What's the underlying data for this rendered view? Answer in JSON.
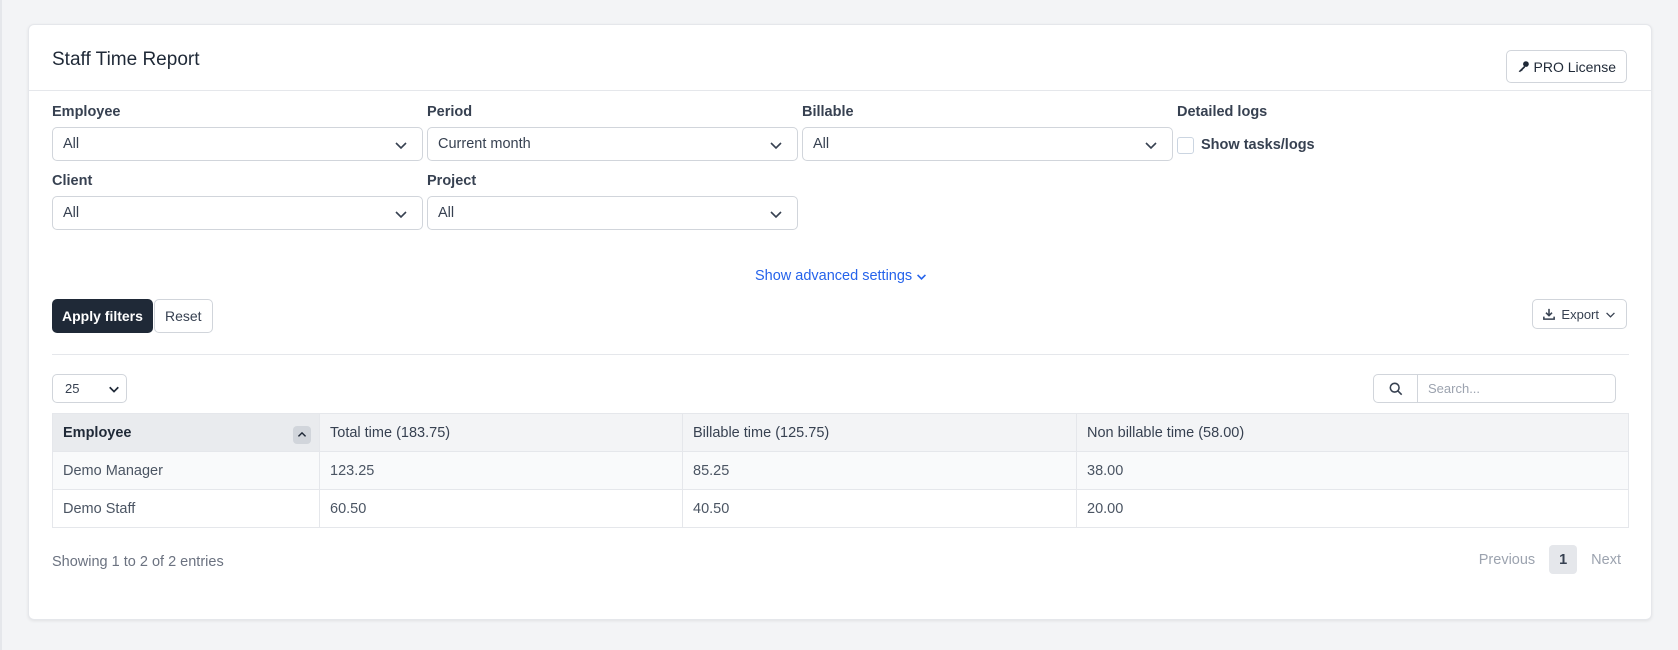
{
  "header": {
    "title": "Staff Time Report",
    "pro_button": "PRO License"
  },
  "filters": {
    "employee": {
      "label": "Employee",
      "value": "All"
    },
    "period": {
      "label": "Period",
      "value": "Current month"
    },
    "billable": {
      "label": "Billable",
      "value": "All"
    },
    "detailed_logs": {
      "label": "Detailed logs",
      "checkbox_label": "Show tasks/logs",
      "checked": false
    },
    "client": {
      "label": "Client",
      "value": "All"
    },
    "project": {
      "label": "Project",
      "value": "All"
    },
    "advanced_link": "Show advanced settings"
  },
  "actions": {
    "apply": "Apply filters",
    "reset": "Reset",
    "export": "Export"
  },
  "table_controls": {
    "page_length": "25",
    "search_placeholder": "Search..."
  },
  "table": {
    "columns": [
      "Employee",
      "Total time (183.75)",
      "Billable time (125.75)",
      "Non billable time (58.00)"
    ],
    "rows": [
      [
        "Demo Manager",
        "123.25",
        "85.25",
        "38.00"
      ],
      [
        "Demo Staff",
        "60.50",
        "40.50",
        "20.00"
      ]
    ]
  },
  "footer": {
    "info": "Showing 1 to 2 of 2 entries",
    "prev": "Previous",
    "page": "1",
    "next": "Next"
  }
}
